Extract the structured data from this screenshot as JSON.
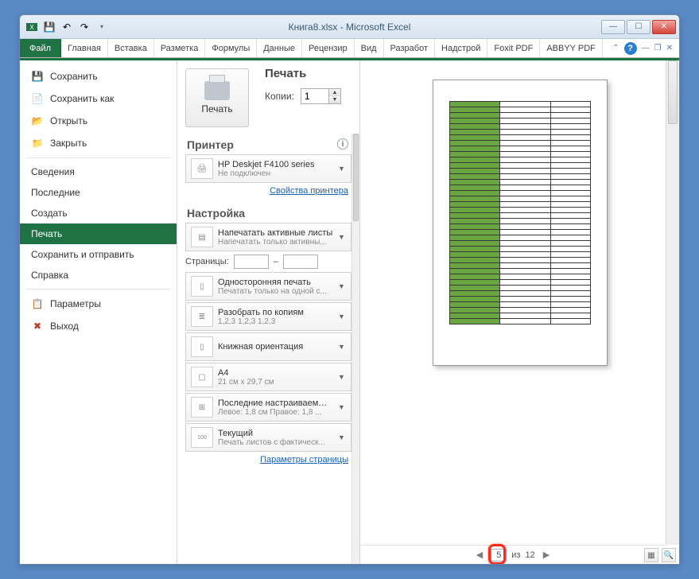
{
  "title": {
    "doc": "Книга8.xlsx",
    "sep": " - ",
    "app": "Microsoft Excel"
  },
  "ribbon": {
    "file": "Файл",
    "tabs": [
      "Главная",
      "Вставка",
      "Разметка",
      "Формулы",
      "Данные",
      "Рецензир",
      "Вид",
      "Разработ",
      "Надстрой",
      "Foxit PDF",
      "ABBYY PDF"
    ]
  },
  "nav": {
    "save": "Сохранить",
    "saveas": "Сохранить как",
    "open": "Открыть",
    "close": "Закрыть",
    "info": "Сведения",
    "recent": "Последние",
    "new": "Создать",
    "print": "Печать",
    "sendsave": "Сохранить и отправить",
    "help": "Справка",
    "options": "Параметры",
    "exit": "Выход"
  },
  "print": {
    "heading": "Печать",
    "button_label": "Печать",
    "copies_label": "Копии:",
    "copies_value": "1",
    "printer_section": "Принтер",
    "printer_name": "HP Deskjet F4100 series",
    "printer_status": "Не подключен",
    "printer_props": "Свойства принтера",
    "settings_section": "Настройка",
    "opt_active_t1": "Напечатать активные листы",
    "opt_active_t2": "Напечатать только активны...",
    "pages_label": "Страницы:",
    "pages_dash": "–",
    "opt_sides_t1": "Односторонняя печать",
    "opt_sides_t2": "Печатать только на одной с...",
    "opt_collate_t1": "Разобрать по копиям",
    "opt_collate_t2": "1,2,3   1,2,3   1,2,3",
    "opt_orient_t1": "Книжная ориентация",
    "opt_size_t1": "A4",
    "opt_size_t2": "21 см x 29,7 см",
    "opt_margins_t1": "Последние настраиваемые ...",
    "opt_margins_t2": "Левое: 1,8 см   Правое: 1,8 ...",
    "opt_scale_t1": "Текущий",
    "opt_scale_t2": "Печать листов с фактическ...",
    "page_setup": "Параметры страницы"
  },
  "pager": {
    "current": "5",
    "of_label": "из",
    "total": "12"
  },
  "preview_rows": 40
}
